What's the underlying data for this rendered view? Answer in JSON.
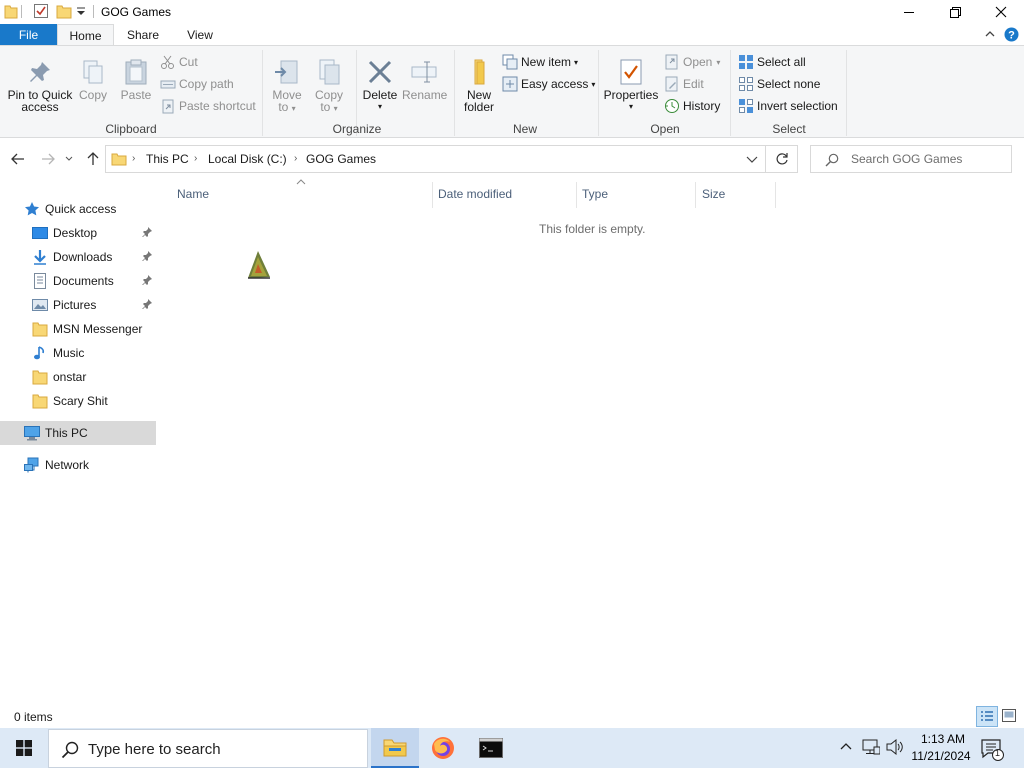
{
  "window": {
    "title": "GOG Games",
    "quick_access_toolbar": [
      "folder-icon",
      "properties-check-icon",
      "new-folder-icon",
      "customize-dropdown-icon"
    ],
    "controls": [
      "minimize-icon",
      "restore-icon",
      "close-icon"
    ]
  },
  "ribbon": {
    "tabs": [
      {
        "label": "File",
        "active": false
      },
      {
        "label": "Home",
        "active": true
      },
      {
        "label": "Share",
        "active": false
      },
      {
        "label": "View",
        "active": false
      }
    ],
    "clipboard": {
      "group_label": "Clipboard",
      "pin_line1": "Pin to Quick",
      "pin_line2": "access",
      "copy": "Copy",
      "paste": "Paste",
      "cut": "Cut",
      "copy_path": "Copy path",
      "paste_shortcut": "Paste shortcut"
    },
    "organize": {
      "group_label": "Organize",
      "move_line1": "Move",
      "move_line2": "to",
      "copy_line1": "Copy",
      "copy_line2": "to",
      "delete": "Delete",
      "rename": "Rename"
    },
    "new": {
      "group_label": "New",
      "new_folder_line1": "New",
      "new_folder_line2": "folder",
      "new_item": "New item",
      "easy_access": "Easy access"
    },
    "open": {
      "group_label": "Open",
      "properties": "Properties",
      "open": "Open",
      "edit": "Edit",
      "history": "History"
    },
    "select": {
      "group_label": "Select",
      "select_all": "Select all",
      "select_none": "Select none",
      "invert_selection": "Invert selection"
    }
  },
  "address_bar": {
    "breadcrumbs": [
      "This PC",
      "Local Disk (C:)",
      "GOG Games"
    ],
    "search_placeholder": "Search GOG Games"
  },
  "nav_pane": {
    "quick_access": "Quick access",
    "items": [
      {
        "label": "Desktop",
        "icon": "desktop-icon",
        "pinned": true
      },
      {
        "label": "Downloads",
        "icon": "downloads-icon",
        "pinned": true
      },
      {
        "label": "Documents",
        "icon": "documents-icon",
        "pinned": true
      },
      {
        "label": "Pictures",
        "icon": "pictures-icon",
        "pinned": true
      },
      {
        "label": "MSN Messenger",
        "icon": "folder-icon",
        "pinned": false
      },
      {
        "label": "Music",
        "icon": "music-icon",
        "pinned": false
      },
      {
        "label": "onstar",
        "icon": "folder-icon",
        "pinned": false
      },
      {
        "label": "Scary Shit",
        "icon": "folder-icon",
        "pinned": false
      }
    ],
    "this_pc": "This PC",
    "network": "Network"
  },
  "file_list": {
    "columns": [
      "Name",
      "Date modified",
      "Type",
      "Size"
    ],
    "sort_column": "Name",
    "empty_message": "This folder is empty."
  },
  "status_bar": {
    "item_count": "0 items",
    "view_buttons": [
      "details-view-icon",
      "large-icons-view-icon"
    ]
  },
  "taskbar": {
    "search_placeholder": "Type here to search",
    "apps": [
      "file-explorer-icon",
      "firefox-icon",
      "command-prompt-icon"
    ],
    "time": "1:13 AM",
    "date": "11/21/2024",
    "notification_count": "1"
  },
  "colors": {
    "file_tab": "#1979ca",
    "ribbon_bg": "#f5f6f7",
    "selected_nav": "#d9d9d9",
    "taskbar_bg": "#dde9f6",
    "column_header_text": "#4c607a",
    "folder_yellow": "#f8d775"
  }
}
